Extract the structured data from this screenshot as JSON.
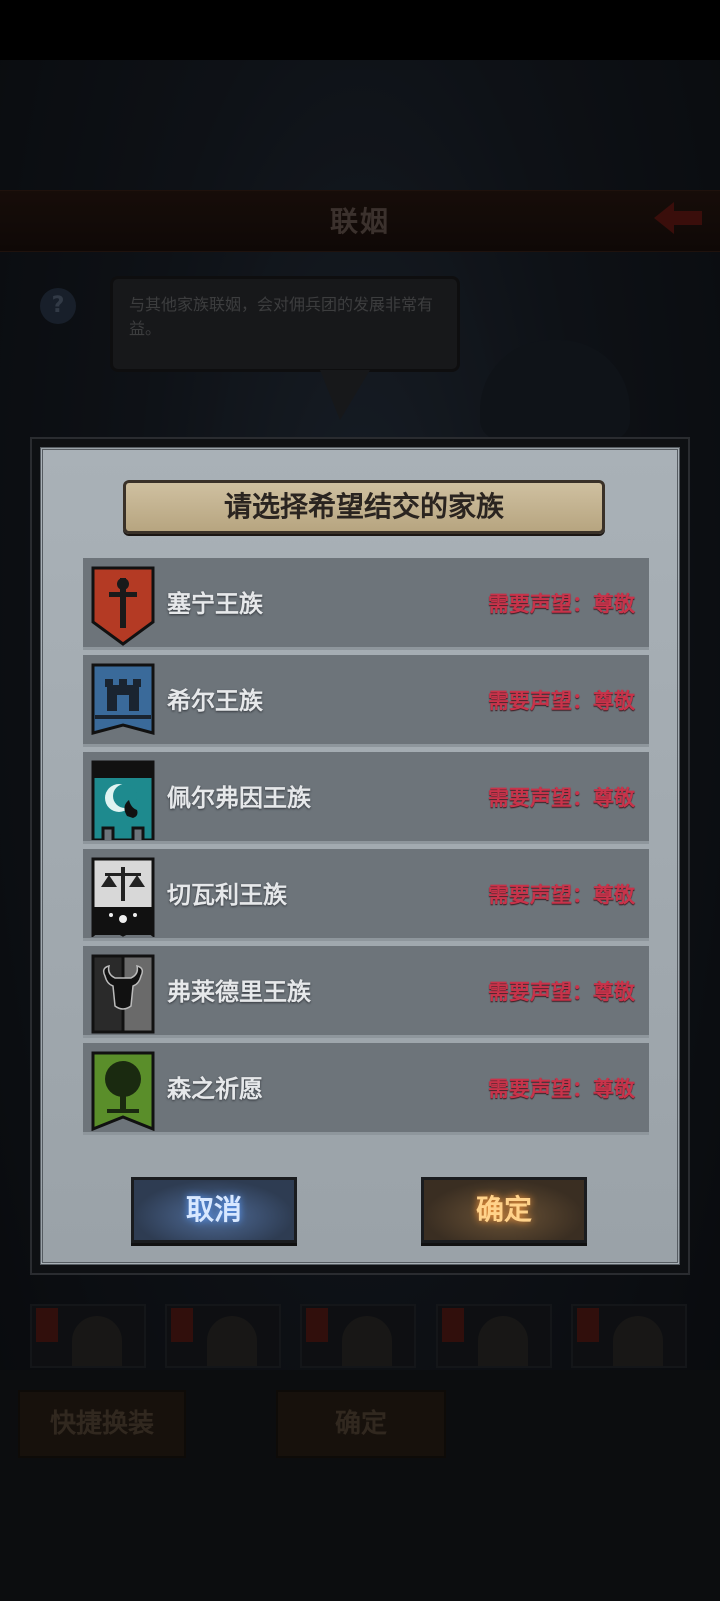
{
  "background": {
    "screen_title": "联姻",
    "help_icon": "question-icon",
    "speech_bubble": "与其他家族联姻，会对佣兵团的发展非常有益。",
    "buttons": {
      "quick_change": "快捷换装",
      "confirm": "确定"
    }
  },
  "dialog": {
    "title": "请选择希望结交的家族",
    "houses": [
      {
        "name": "塞宁王族",
        "requirement": "需要声望：尊敬",
        "crest": "sword-crest-icon",
        "color": "#b43a24"
      },
      {
        "name": "希尔王族",
        "requirement": "需要声望：尊敬",
        "crest": "castle-crest-icon",
        "color": "#3a6a9a"
      },
      {
        "name": "佩尔弗因王族",
        "requirement": "需要声望：尊敬",
        "crest": "moon-flame-crest-icon",
        "color": "#1e8a8e"
      },
      {
        "name": "切瓦利王族",
        "requirement": "需要声望：尊敬",
        "crest": "scales-crest-icon",
        "color": "#d8d8d8"
      },
      {
        "name": "弗莱德里王族",
        "requirement": "需要声望：尊敬",
        "crest": "bull-crest-icon",
        "color": "#4a4a4a"
      },
      {
        "name": "森之祈愿",
        "requirement": "需要声望：尊敬",
        "crest": "tree-crest-icon",
        "color": "#5a8e2a"
      }
    ],
    "cancel_label": "取消",
    "confirm_label": "确定"
  }
}
